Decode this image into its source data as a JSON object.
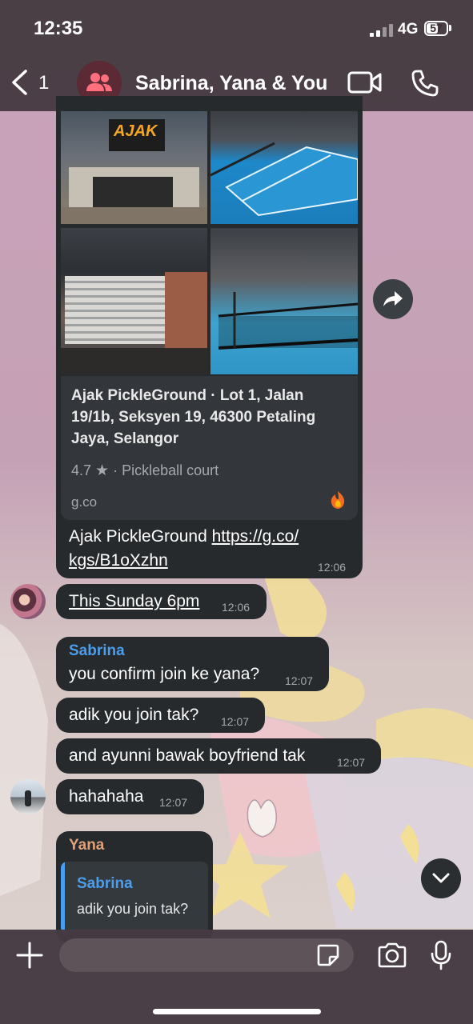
{
  "status": {
    "time": "12:35",
    "network": "4G",
    "battery": "57",
    "battery_level": 0.57
  },
  "header": {
    "back_count": "1",
    "title": "Sabrina, Yana & You"
  },
  "link_message": {
    "preview_title": "Ajak PickleGround · Lot 1, Jalan 19/1b, Seksyen 19, 46300 Petaling Jaya, Selangor",
    "preview_lines": [
      "Ajak PickleGround · Lot 1, Jalan",
      "19/1b, Seksyen 19, 46300 Petaling",
      "Jaya, Selangor"
    ],
    "rating": "4.7",
    "category": "· Pickleball court",
    "domain": "g.co",
    "text_prefix": "Ajak PickleGround",
    "url_line1": "https://g.co/",
    "url_line2": "kgs/B1oXzhn",
    "time": "12:06",
    "photo_sign": "AJAK"
  },
  "messages": [
    {
      "text": "This Sunday 6pm",
      "time": "12:06"
    },
    {
      "sender": "Sabrina",
      "sender_color": "#4a9eed",
      "text": "you confirm join ke yana?",
      "time": "12:07"
    },
    {
      "text": "adik you join tak?",
      "time": "12:07"
    },
    {
      "text": "and ayunni bawak boyfriend tak",
      "time": "12:07"
    },
    {
      "text": "hahahaha",
      "time": "12:07"
    }
  ],
  "reply_message": {
    "sender": "Yana",
    "sender_color": "#e0a079",
    "quoted_sender": "Sabrina",
    "quoted_text": "adik you join tak?"
  },
  "icons": [
    "chevron-left-icon",
    "group-icon",
    "video-call-icon",
    "phone-icon",
    "forward-icon",
    "scroll-down-icon",
    "plus-icon",
    "sticker-icon",
    "camera-icon",
    "microphone-icon"
  ]
}
